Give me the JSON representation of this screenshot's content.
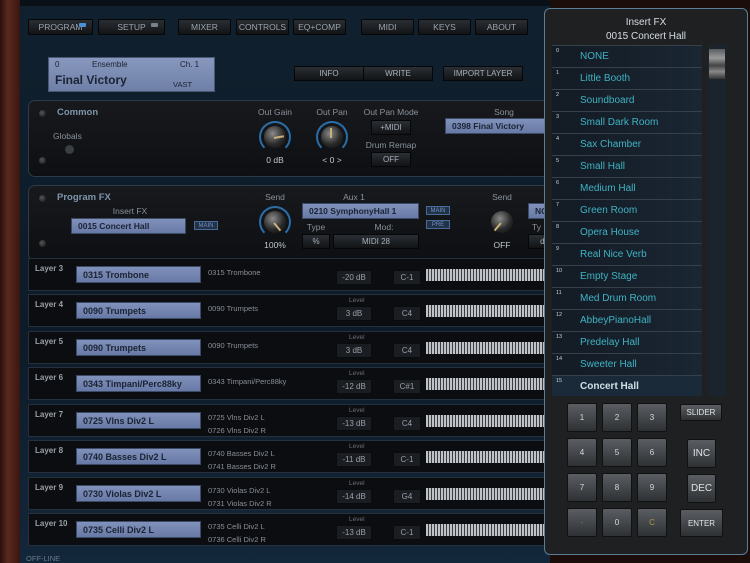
{
  "nav": {
    "tabs": [
      {
        "label": "PROGRAM",
        "led": "#4a90d9"
      },
      {
        "label": "SETUP",
        "led": "#7a8088"
      },
      {
        "label": "MIXER"
      },
      {
        "label": "CONTROLS"
      },
      {
        "label": "EQ+COMP"
      },
      {
        "label": "MIDI"
      },
      {
        "label": "KEYS"
      },
      {
        "label": "ABOUT"
      }
    ]
  },
  "lcd": {
    "number": "0",
    "category": "Ensemble",
    "channel": "Ch. 1",
    "name": "Final Victory",
    "library": "VAST"
  },
  "actions": {
    "info": "INFO",
    "write": "WRITE",
    "import_layer": "IMPORT LAYER"
  },
  "common": {
    "title": "Common",
    "globals_label": "Globals",
    "out_gain_label": "Out Gain",
    "out_gain_value": "0 dB",
    "out_pan_label": "Out Pan",
    "out_pan_value": "< 0 >",
    "out_pan_mode_label": "Out Pan Mode",
    "out_pan_mode_value": "+MIDI",
    "drum_remap_label": "Drum Remap",
    "drum_remap_value": "OFF",
    "song_label": "Song",
    "song_value": "0398 Final Victory"
  },
  "program_fx": {
    "title": "Program FX",
    "insert_fx_label": "Insert FX",
    "insert_fx_value": "0015 Concert Hall",
    "insert_tag": "MAIN",
    "send1_label": "Send",
    "send1_value": "100%",
    "aux1_label": "Aux 1",
    "aux1_value": "0210 SymphonyHall 1",
    "aux1_tag_main": "MAIN",
    "aux1_tag_pre": "PRE",
    "type_label": "Type",
    "type_value": "%",
    "mod_label": "Mod:",
    "mod_value": "MIDI 28",
    "send2_label": "Send",
    "send2_value": "OFF",
    "aux2_value_partial": "NC",
    "type2_label_partial": "Ty",
    "type2_value_partial": "dI"
  },
  "layers": [
    {
      "name": "Layer 3",
      "program": "0315 Trombone",
      "sub1": "0315 Trombone",
      "sub2": "",
      "level_label": "",
      "level": "-20 dB",
      "key": "C-1"
    },
    {
      "name": "Layer 4",
      "program": "0090 Trumpets",
      "sub1": "0090 Trumpets",
      "sub2": "",
      "level_label": "Level",
      "level": "3 dB",
      "key": "C4"
    },
    {
      "name": "Layer 5",
      "program": "0090 Trumpets",
      "sub1": "0090 Trumpets",
      "sub2": "",
      "level_label": "Level",
      "level": "3 dB",
      "key": "C4"
    },
    {
      "name": "Layer 6",
      "program": "0343 Timpani/Perc88ky",
      "sub1": "0343 Timpani/Perc88ky",
      "sub2": "",
      "level_label": "Level",
      "level": "-12 dB",
      "key": "C#1"
    },
    {
      "name": "Layer 7",
      "program": "0725 Vlns Div2 L",
      "sub1": "0725 Vlns Div2 L",
      "sub2": "0726 Vlns Div2 R",
      "level_label": "Level",
      "level": "-13 dB",
      "key": "C4"
    },
    {
      "name": "Layer 8",
      "program": "0740 Basses Div2 L",
      "sub1": "0740 Basses Div2 L",
      "sub2": "0741 Basses Div2 R",
      "level_label": "Level",
      "level": "-11 dB",
      "key": "C-1"
    },
    {
      "name": "Layer 9",
      "program": "0730 Violas Div2 L",
      "sub1": "0730 Violas Div2 L",
      "sub2": "0731 Violas Div2 R",
      "level_label": "Level",
      "level": "-14 dB",
      "key": "G4"
    },
    {
      "name": "Layer 10",
      "program": "0735 Celli Div2 L",
      "sub1": "0735 Celli Div2 L",
      "sub2": "0736 Celli Div2 R",
      "level_label": "Level",
      "level": "-13 dB",
      "key": "C-1"
    }
  ],
  "status": "OFF-LINE",
  "popup": {
    "title": "Insert FX",
    "subtitle": "0015 Concert Hall",
    "selected_index": 15,
    "items": [
      {
        "num": "0",
        "label": "NONE"
      },
      {
        "num": "1",
        "label": "Little Booth"
      },
      {
        "num": "2",
        "label": "Soundboard"
      },
      {
        "num": "3",
        "label": "Small Dark Room"
      },
      {
        "num": "4",
        "label": "Sax Chamber"
      },
      {
        "num": "5",
        "label": "Small Hall"
      },
      {
        "num": "6",
        "label": "Medium Hall"
      },
      {
        "num": "7",
        "label": "Green Room"
      },
      {
        "num": "8",
        "label": "Opera House"
      },
      {
        "num": "9",
        "label": "Real Nice Verb"
      },
      {
        "num": "10",
        "label": "Empty Stage"
      },
      {
        "num": "11",
        "label": "Med Drum Room"
      },
      {
        "num": "12",
        "label": "AbbeyPianoHall"
      },
      {
        "num": "13",
        "label": "Predelay Hall"
      },
      {
        "num": "14",
        "label": "Sweeter Hall"
      },
      {
        "num": "15",
        "label": "Concert Hall"
      }
    ],
    "keypad": [
      "1",
      "2",
      "3",
      "4",
      "5",
      "6",
      "7",
      "8",
      "9",
      "-",
      "0",
      "C"
    ],
    "slider": "SLIDER",
    "inc": "INC",
    "dec": "DEC",
    "enter": "ENTER"
  }
}
